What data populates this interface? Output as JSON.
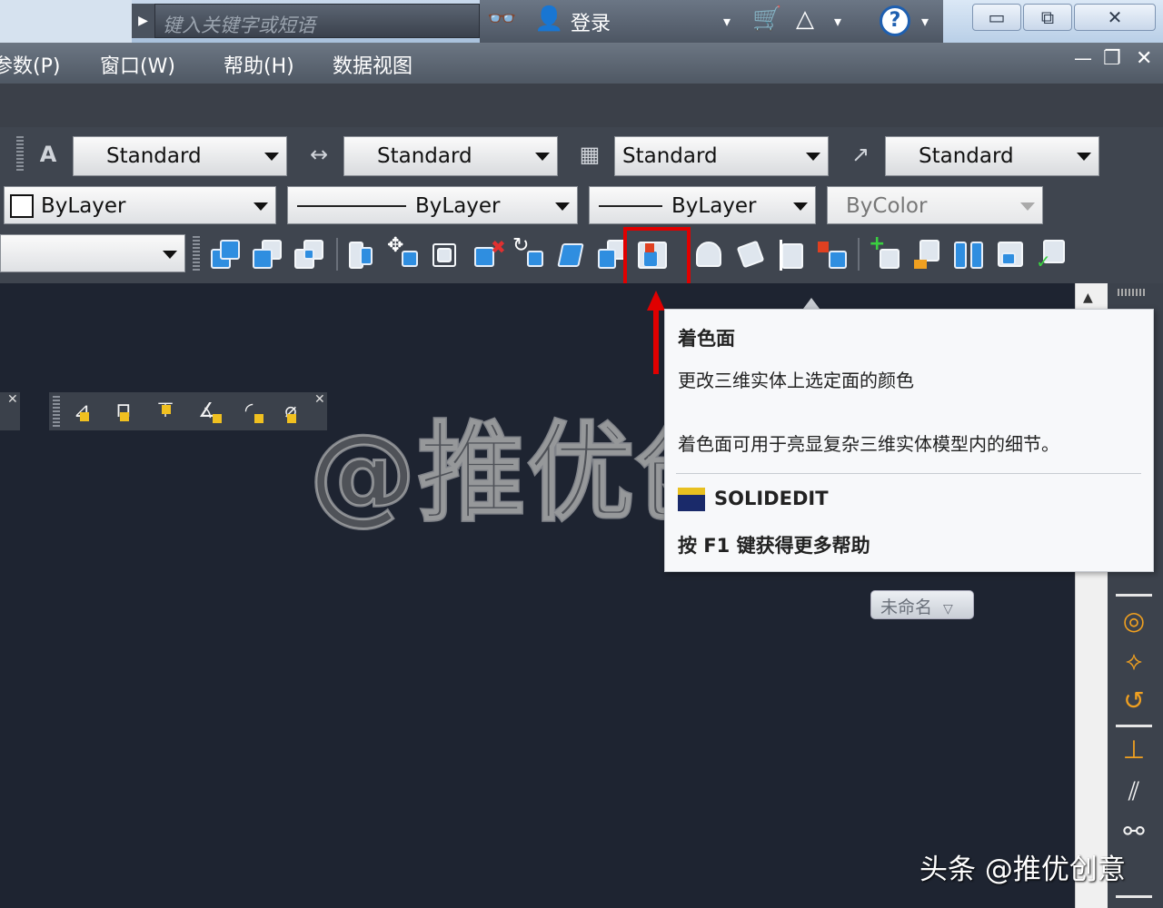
{
  "titlebar": {
    "search_placeholder": "键入关键字或短语",
    "login_label": "登录",
    "icons": [
      "binoculars-icon",
      "user-icon",
      "cart-icon",
      "autodesk-icon",
      "help-icon"
    ],
    "help_glyph": "?",
    "window_buttons": {
      "minimize": "▭",
      "restore": "⧉",
      "close": "✕"
    }
  },
  "menubar": {
    "items": [
      "参数(P)",
      "窗口(W)",
      "帮助(H)",
      "数据视图"
    ],
    "window_controls": {
      "minimize": "—",
      "restore": "❐",
      "close": "✕"
    }
  },
  "styles_toolbar": {
    "text_style": "Standard",
    "dim_style": "Standard",
    "table_style": "Standard",
    "multileader_style": "Standard"
  },
  "properties_toolbar": {
    "color": "ByLayer",
    "linetype": "ByLayer",
    "lineweight": "ByLayer",
    "plot_style": "ByColor"
  },
  "solid_editing_toolbar": {
    "highlighted_tool": "color-faces-tool",
    "highlight_color": "#e00000"
  },
  "tooltip": {
    "title": "着色面",
    "description": "更改三维实体上选定面的颜色",
    "detail": "着色面可用于亮显复杂三维实体模型内的细节。",
    "command": "SOLIDEDIT",
    "help_hint": "按 F1 键获得更多帮助"
  },
  "viewport": {
    "view_control": "未命名",
    "watermark": "@推优创意"
  },
  "credit": "头条 @推优创意",
  "colors": {
    "canvas": "#1e2431",
    "toolbar": "#3f454f",
    "accent_blue": "#2f8ee0",
    "icon_orange": "#f0a020"
  }
}
